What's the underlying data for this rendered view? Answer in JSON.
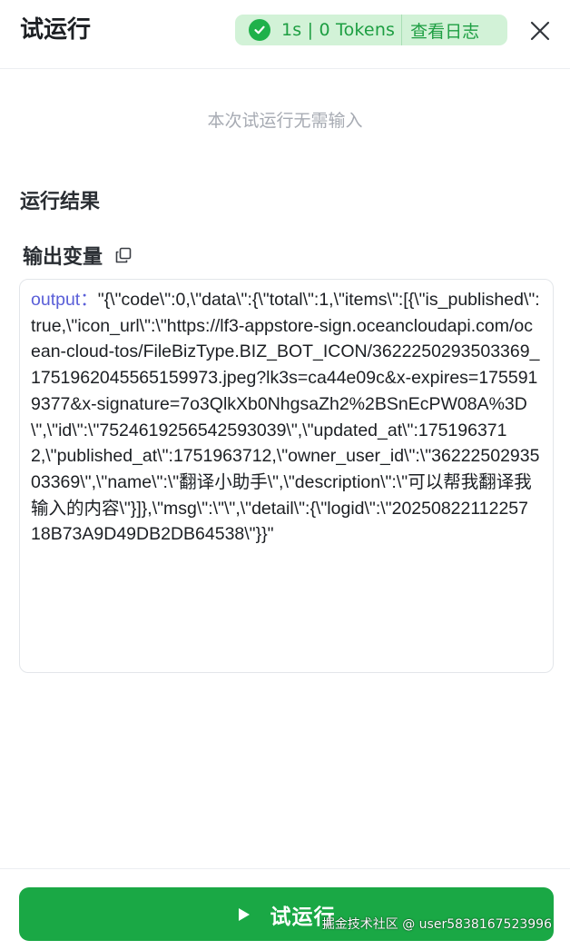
{
  "header": {
    "title": "试运行",
    "status": {
      "duration_tokens": "1s | 0 Tokens",
      "log_link": "查看日志",
      "success_icon": "check-circle-icon",
      "color": "#1d9e42",
      "background": "#d2f2d7"
    },
    "close_icon": "close-icon"
  },
  "input_section": {
    "hint": "本次试运行无需输入"
  },
  "result_section": {
    "title": "运行结果",
    "output_label": "输出变量",
    "copy_icon": "copy-icon",
    "output": {
      "key": "output",
      "separator": "：",
      "value": "\"{\\\"code\\\":0,\\\"data\\\":{\\\"total\\\":1,\\\"items\\\":[{\\\"is_published\\\":true,\\\"icon_url\\\":\\\"https://lf3-appstore-sign.oceancloudapi.com/ocean-cloud-tos/FileBizType.BIZ_BOT_ICON/3622250293503369_1751962045565159973.jpeg?lk3s=ca44e09c&x-expires=1755919377&x-signature=7o3QlkXb0NhgsaZh2%2BSnEcPW08A%3D\\\",\\\"id\\\":\\\"7524619256542593039\\\",\\\"updated_at\\\":1751963712,\\\"published_at\\\":1751963712,\\\"owner_user_id\\\":\\\"3622250293503369\\\",\\\"name\\\":\\\"翻译小助手\\\",\\\"description\\\":\\\"可以帮我翻译我输入的内容\\\"}]},\\\"msg\\\":\\\"\\\",\\\"detail\\\":{\\\"logid\\\":\\\"20250822112257 18B73A9D49DB2DB64538\\\"}}\""
    }
  },
  "footer": {
    "run_button_label": "试运行",
    "run_icon": "play-icon",
    "accent_color": "#1aa845"
  },
  "watermark": "掘金技术社区 @ user5838167523996"
}
